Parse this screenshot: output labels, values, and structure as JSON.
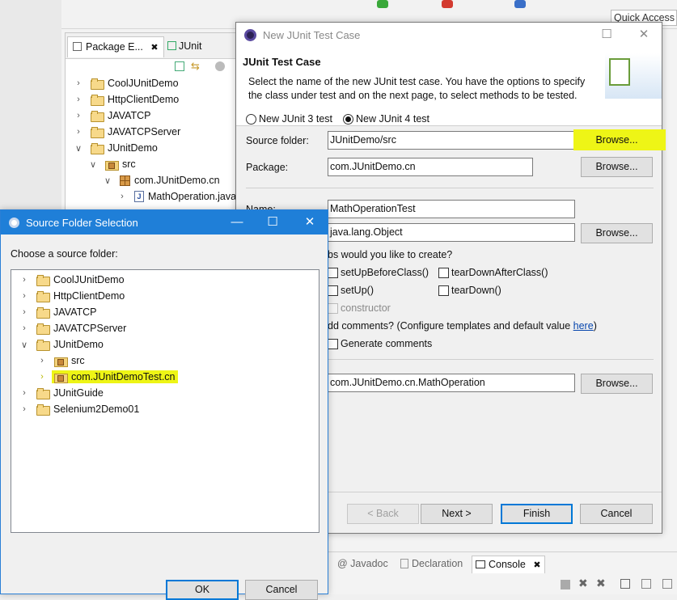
{
  "workbench": {
    "quick_access": "Quick Access",
    "package_explorer": {
      "tab_label": "Package E...",
      "junit_tab_label": "JUnit",
      "tree": [
        {
          "label": "CoolJUnitDemo",
          "kind": "project",
          "expanded": false
        },
        {
          "label": "HttpClientDemo",
          "kind": "project",
          "expanded": false
        },
        {
          "label": "JAVATCP",
          "kind": "project",
          "expanded": false
        },
        {
          "label": "JAVATCPServer",
          "kind": "project",
          "expanded": false
        },
        {
          "label": "JUnitDemo",
          "kind": "project",
          "expanded": true
        },
        {
          "label": "src",
          "kind": "source-folder",
          "expanded": true
        },
        {
          "label": "com.JUnitDemo.cn",
          "kind": "package",
          "expanded": true
        },
        {
          "label": "MathOperation.java",
          "kind": "java-file",
          "expanded": false
        }
      ]
    },
    "bottom_tabs": [
      {
        "label": "Javadoc",
        "active": false
      },
      {
        "label": "Declaration",
        "active": false
      },
      {
        "label": "Console",
        "active": true
      }
    ]
  },
  "junit_dialog": {
    "title": "New JUnit Test Case",
    "heading": "JUnit Test Case",
    "description_line1": "Select the name of the new JUnit test case. You have the options to specify",
    "description_line2": "the class under test and on the next page, to select methods to be tested.",
    "radio_junit3": "New JUnit 3 test",
    "radio_junit4": "New JUnit 4 test",
    "selected_version": "New JUnit 4 test",
    "source_folder_label": "Source folder:",
    "source_folder_value": "JUnitDemo/src",
    "package_label": "Package:",
    "package_value": "com.JUnitDemo.cn",
    "name_label": "Name:",
    "name_value": "MathOperationTest",
    "superclass_value": "java.lang.Object",
    "stubs_question": "bs would you like to create?",
    "stubs": {
      "setup_before_class": "setUpBeforeClass()",
      "teardown_after_class": "tearDownAfterClass()",
      "setup": "setUp()",
      "teardown": "tearDown()",
      "constructor": "constructor"
    },
    "comments_question_prefix": "dd comments? (Configure templates and default value ",
    "comments_link": "here",
    "comments_question_suffix": ")",
    "generate_comments": "Generate comments",
    "class_under_test_value": "com.JUnitDemo.cn.MathOperation",
    "browse_label": "Browse...",
    "back_label": "< Back",
    "next_label": "Next >",
    "finish_label": "Finish",
    "cancel_label": "Cancel",
    "highlight_color": "#eef516"
  },
  "source_dialog": {
    "title": "Source Folder Selection",
    "prompt": "Choose a source folder:",
    "tree": [
      {
        "label": "CoolJUnitDemo",
        "kind": "project",
        "expanded": false
      },
      {
        "label": "HttpClientDemo",
        "kind": "project",
        "expanded": false
      },
      {
        "label": "JAVATCP",
        "kind": "project",
        "expanded": false
      },
      {
        "label": "JAVATCPServer",
        "kind": "project",
        "expanded": false
      },
      {
        "label": "JUnitDemo",
        "kind": "project",
        "expanded": true
      },
      {
        "label": "src",
        "kind": "source-folder",
        "expanded": false
      },
      {
        "label": "com.JUnitDemoTest.cn",
        "kind": "source-folder",
        "expanded": false,
        "highlighted": true
      },
      {
        "label": "JUnitGuide",
        "kind": "project",
        "expanded": false
      },
      {
        "label": "Selenium2Demo01",
        "kind": "project",
        "expanded": false
      }
    ],
    "ok_label": "OK",
    "cancel_label": "Cancel",
    "title_bar_color": "#1f7fd8"
  }
}
